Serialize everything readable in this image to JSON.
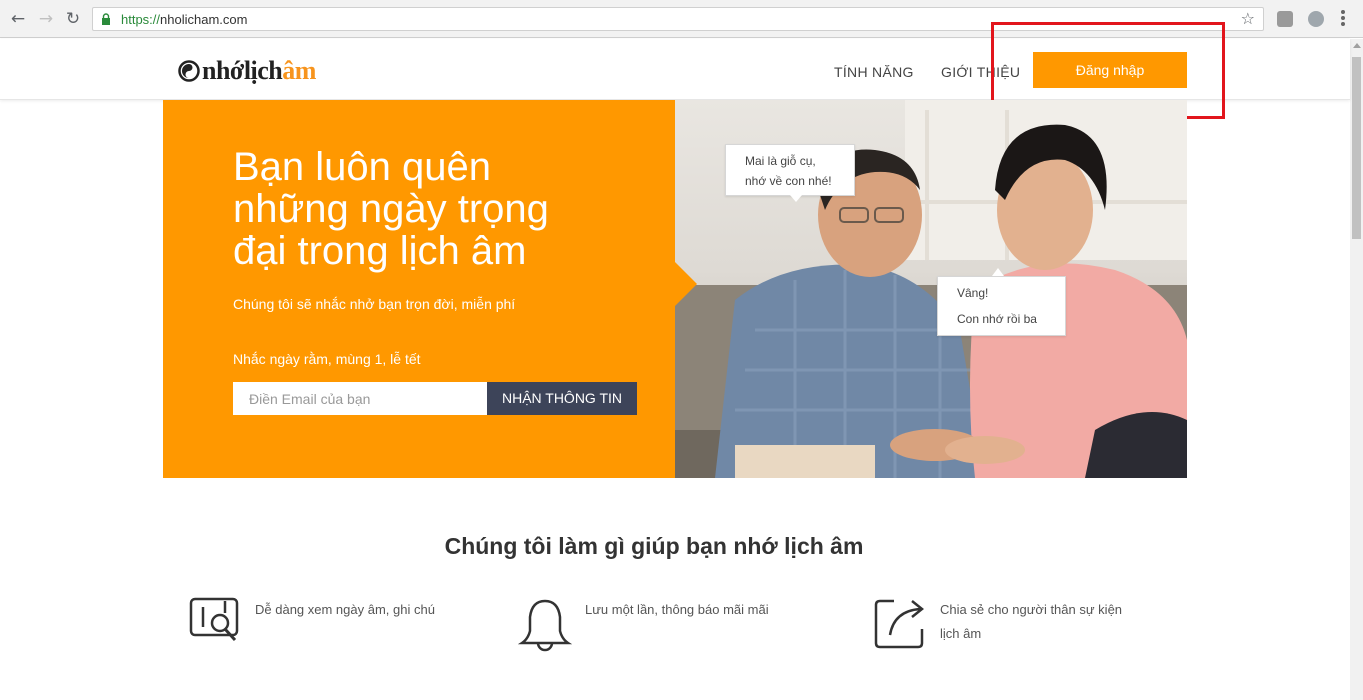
{
  "browser": {
    "url_protocol": "https://",
    "url_host": "nholicham.com"
  },
  "header": {
    "logo_prefix": "nhớlịch",
    "logo_accent": "âm",
    "nav": [
      {
        "label": "TÍNH NĂNG"
      },
      {
        "label": "GIỚI THIỆU"
      }
    ],
    "login_label": "Đăng nhập"
  },
  "hero": {
    "title": "Bạn luôn quên những ngày trọng đại trong lịch âm",
    "subtitle": "Chúng tôi sẽ nhắc nhở bạn trọn đời, miễn phí",
    "reminder": "Nhắc ngày rằm, mùng 1, lễ tết",
    "email_placeholder": "Điền Email của bạn",
    "submit_label": "NHẬN THÔNG TIN",
    "bubble_1": {
      "line1": "Mai là giỗ cụ,",
      "line2": "nhớ về con nhé!"
    },
    "bubble_2": {
      "line1": "Vâng!",
      "line2": "Con nhớ rồi ba"
    }
  },
  "features": {
    "title": "Chúng tôi làm gì giúp bạn nhớ lịch âm",
    "items": [
      {
        "icon": "calendar-search-icon",
        "text": "Dễ dàng xem ngày âm, ghi chú"
      },
      {
        "icon": "bell-icon",
        "text_line1": "Lưu một lần, thông báo mãi mãi"
      },
      {
        "icon": "share-icon",
        "text_line1": "Chia sẻ cho người thân sự kiện",
        "text_line2": "lịch âm"
      }
    ]
  },
  "colors": {
    "brand_orange": "#ff9800",
    "button_dark": "#3d4459",
    "highlight_red": "#e2151c"
  }
}
